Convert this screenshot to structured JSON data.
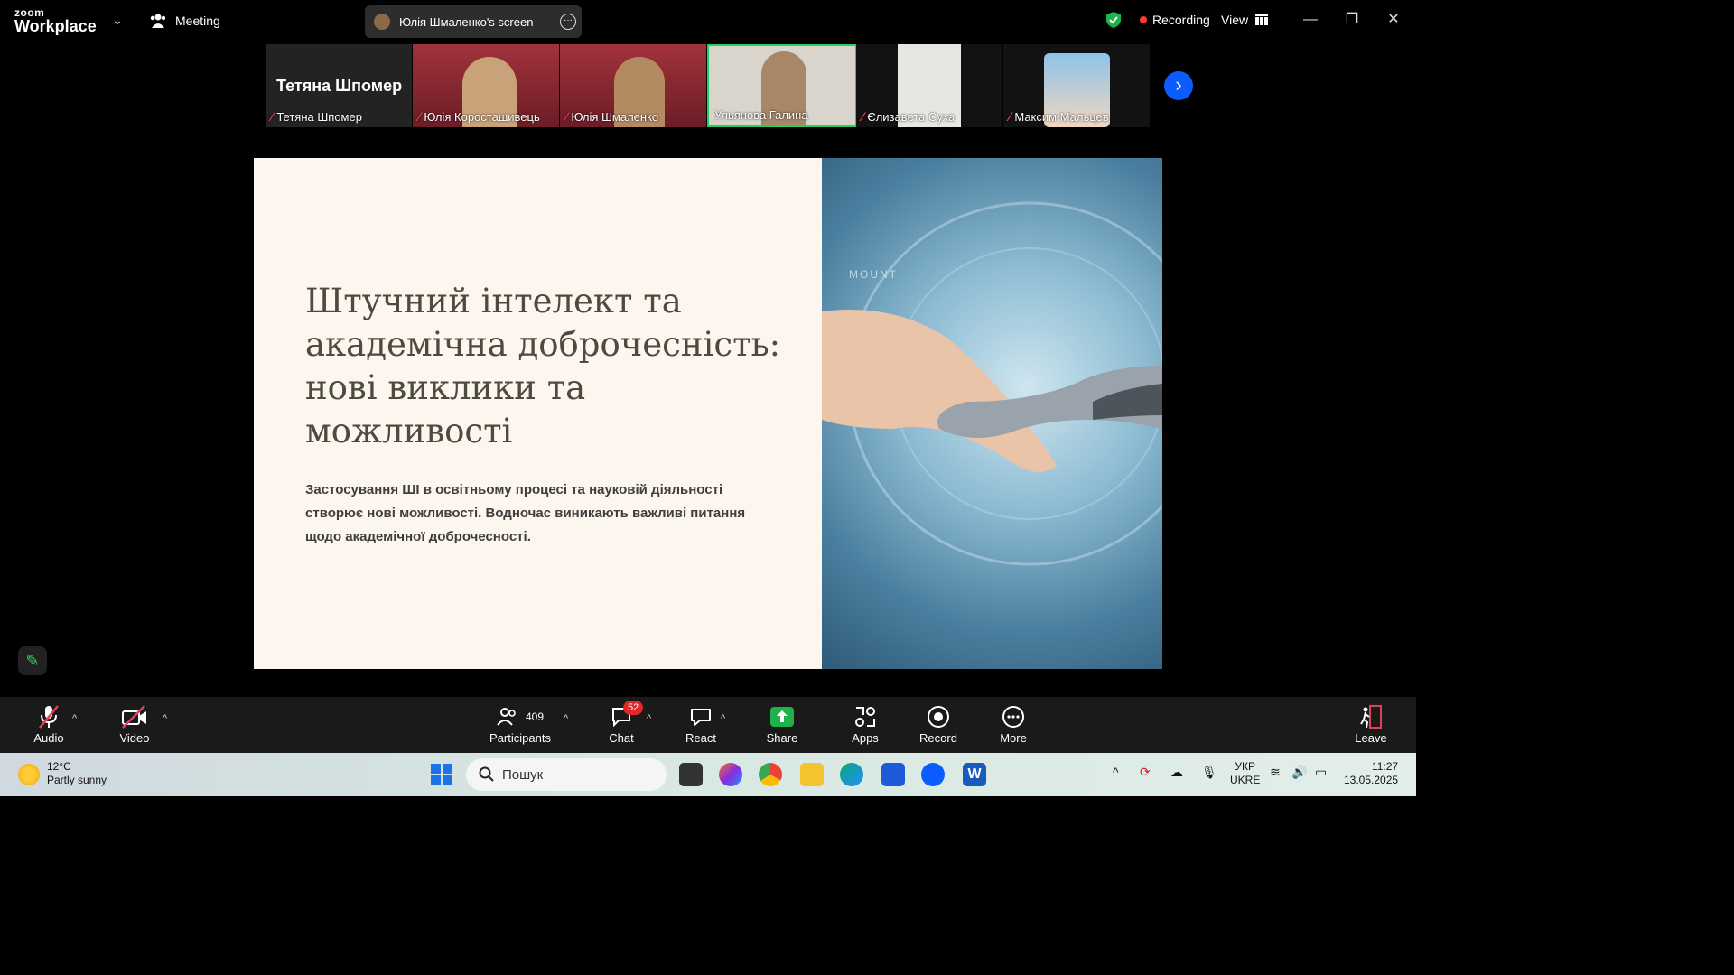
{
  "app": {
    "logo_line1": "zoom",
    "logo_line2": "Workplace",
    "meeting_label": "Meeting"
  },
  "share_banner": {
    "text": "Юлія Шмаленко's screen"
  },
  "status": {
    "recording": "Recording",
    "view": "View"
  },
  "participants_tiles": [
    {
      "name": "Тетяна Шпомер",
      "big_name": "Тетяна Шпомер",
      "muted": true
    },
    {
      "name": "Юлія Короcташивець",
      "muted": true
    },
    {
      "name": "Юлія Шмаленко",
      "muted": true
    },
    {
      "name": "Ульянова Галина",
      "muted": false,
      "active_speaker": true
    },
    {
      "name": "Єлизавета Суха",
      "muted": true
    },
    {
      "name": "Максим Мальцев",
      "muted": true
    }
  ],
  "slide": {
    "title": "Штучний інтелект та академічна доброчесність: нові виклики та можливості",
    "body": "Застосування ШІ в освітньому процесі та науковій діяльності створює нові можливості. Водночас виникають важливі питання щодо академічної доброчесності.",
    "watermark": "MOUNT"
  },
  "toolbar": {
    "audio": "Audio",
    "video": "Video",
    "participants": "Participants",
    "participants_count": "409",
    "chat": "Chat",
    "chat_badge": "52",
    "react": "React",
    "share": "Share",
    "apps": "Apps",
    "record": "Record",
    "more": "More",
    "leave": "Leave"
  },
  "taskbar": {
    "temp": "12°C",
    "weather": "Partly sunny",
    "search_placeholder": "Пошук",
    "lang1": "УКР",
    "lang2": "UKRE",
    "time": "11:27",
    "date": "13.05.2025"
  },
  "colors": {
    "accent": "#0b5cff",
    "share_green": "#1fb24a",
    "mute_red": "#e0405a",
    "recording_red": "#ff3b30",
    "active_border": "#23d160"
  }
}
